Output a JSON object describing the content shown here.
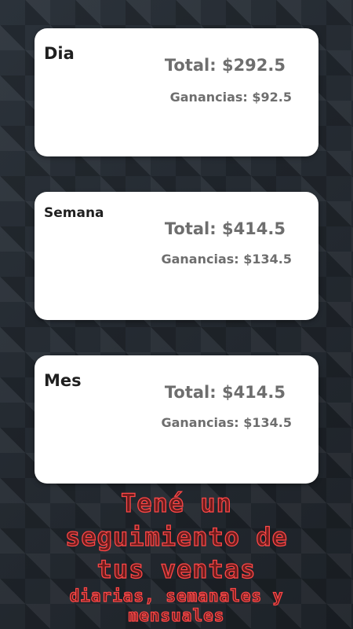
{
  "cards": [
    {
      "title": "Dia",
      "total": "Total: $292.5",
      "ganancias": "Ganancias: $92.5"
    },
    {
      "title": "Semana",
      "total": "Total: $414.5",
      "ganancias": "Ganancias: $134.5"
    },
    {
      "title": "Mes",
      "total": "Total: $414.5",
      "ganancias": "Ganancias: $134.5"
    }
  ],
  "promo": {
    "line1": "Tené un",
    "line2": "seguimiento de",
    "line3": "tus ventas",
    "line4": "diarias, semanales y",
    "line5": "mensuales"
  }
}
